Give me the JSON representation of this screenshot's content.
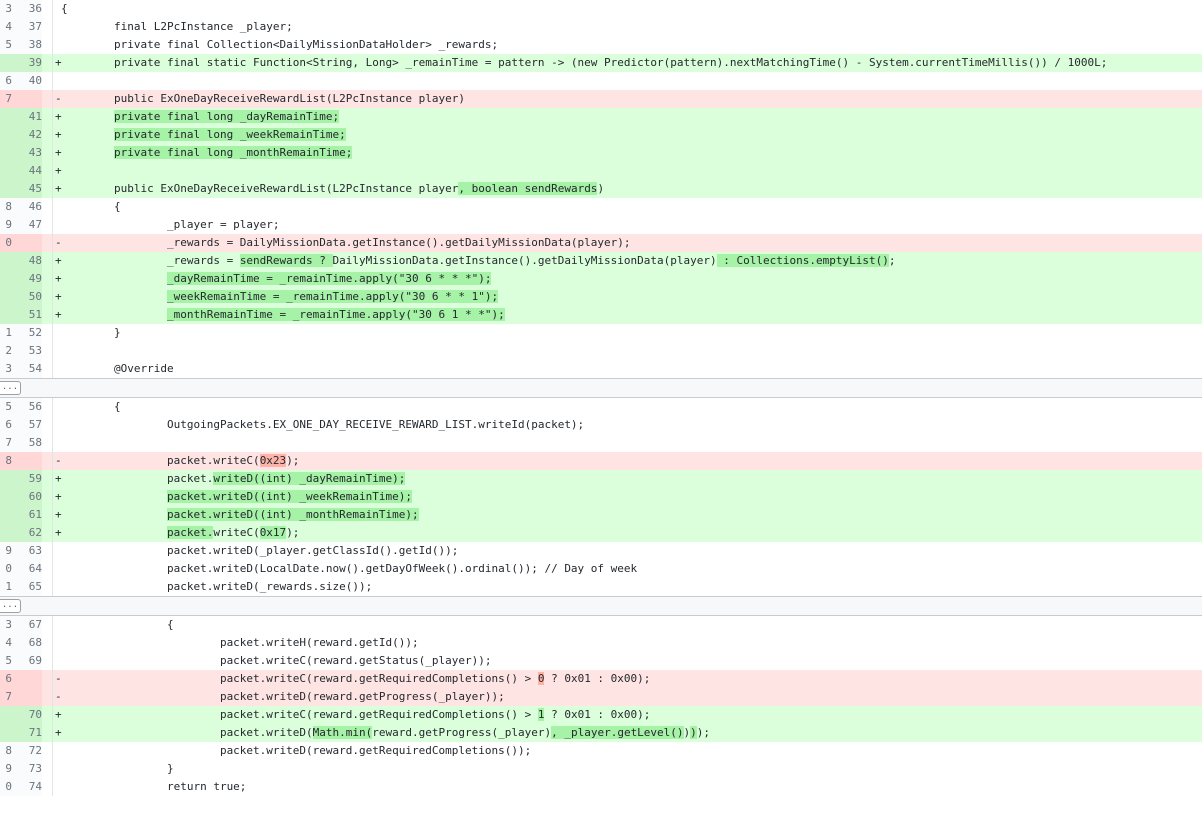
{
  "expand_label": "...",
  "lines": [
    {
      "t": "ctx",
      "o": "3",
      "n": "36",
      "s": "",
      "p": [
        [
          "{",
          ""
        ]
      ]
    },
    {
      "t": "ctx",
      "o": "4",
      "n": "37",
      "s": "",
      "p": [
        [
          "        final L2PcInstance _player;",
          ""
        ]
      ]
    },
    {
      "t": "ctx",
      "o": "5",
      "n": "38",
      "s": "",
      "p": [
        [
          "        private final Collection<DailyMissionDataHolder> _rewards;",
          ""
        ]
      ]
    },
    {
      "t": "add",
      "o": "",
      "n": "39",
      "s": "+",
      "p": [
        [
          "        private final static Function<String, Long> _remainTime = pattern -> (new Predictor(pattern).nextMatchingTime() - System.currentTimeMillis()) / 1000L;",
          ""
        ]
      ]
    },
    {
      "t": "ctx",
      "o": "6",
      "n": "40",
      "s": "",
      "p": [
        [
          "",
          ""
        ]
      ]
    },
    {
      "t": "del",
      "o": "7",
      "n": "",
      "s": "-",
      "p": [
        [
          "        public ExOneDayReceiveRewardList(L2PcInstance player)",
          ""
        ]
      ]
    },
    {
      "t": "add",
      "o": "",
      "n": "41",
      "s": "+",
      "p": [
        [
          "        ",
          ""
        ],
        [
          "private final long _dayRemainTime;",
          "h"
        ]
      ]
    },
    {
      "t": "add",
      "o": "",
      "n": "42",
      "s": "+",
      "p": [
        [
          "        ",
          ""
        ],
        [
          "private final long _weekRemainTime;",
          "h"
        ]
      ]
    },
    {
      "t": "add",
      "o": "",
      "n": "43",
      "s": "+",
      "p": [
        [
          "        ",
          ""
        ],
        [
          "private final long _monthRemainTime;",
          "h"
        ]
      ]
    },
    {
      "t": "add",
      "o": "",
      "n": "44",
      "s": "+",
      "p": [
        [
          "",
          ""
        ]
      ]
    },
    {
      "t": "add",
      "o": "",
      "n": "45",
      "s": "+",
      "p": [
        [
          "        public ExOneDayReceiveRewardList(L2PcInstance player",
          ""
        ],
        [
          ", boolean sendRewards",
          "h"
        ],
        [
          ")",
          ""
        ]
      ]
    },
    {
      "t": "ctx",
      "o": "8",
      "n": "46",
      "s": "",
      "p": [
        [
          "        {",
          ""
        ]
      ]
    },
    {
      "t": "ctx",
      "o": "9",
      "n": "47",
      "s": "",
      "p": [
        [
          "                _player = player;",
          ""
        ]
      ]
    },
    {
      "t": "del",
      "o": "0",
      "n": "",
      "s": "-",
      "p": [
        [
          "                _rewards = DailyMissionData.getInstance().getDailyMissionData(player);",
          ""
        ]
      ]
    },
    {
      "t": "add",
      "o": "",
      "n": "48",
      "s": "+",
      "p": [
        [
          "                _rewards = ",
          ""
        ],
        [
          "sendRewards ? ",
          "h"
        ],
        [
          "DailyMissionData.getInstance().getDailyMissionData(player)",
          ""
        ],
        [
          " : Collections.emptyList()",
          "h"
        ],
        [
          ";",
          ""
        ]
      ]
    },
    {
      "t": "add",
      "o": "",
      "n": "49",
      "s": "+",
      "p": [
        [
          "                ",
          ""
        ],
        [
          "_dayRemainTime = _remainTime.apply(\"30 6 * * *\");",
          "h"
        ]
      ]
    },
    {
      "t": "add",
      "o": "",
      "n": "50",
      "s": "+",
      "p": [
        [
          "                ",
          ""
        ],
        [
          "_weekRemainTime = _remainTime.apply(\"30 6 * * 1\");",
          "h"
        ]
      ]
    },
    {
      "t": "add",
      "o": "",
      "n": "51",
      "s": "+",
      "p": [
        [
          "                ",
          ""
        ],
        [
          "_monthRemainTime = _remainTime.apply(\"30 6 1 * *\");",
          "h"
        ]
      ]
    },
    {
      "t": "ctx",
      "o": "1",
      "n": "52",
      "s": "",
      "p": [
        [
          "        }",
          ""
        ]
      ]
    },
    {
      "t": "ctx",
      "o": "2",
      "n": "53",
      "s": "",
      "p": [
        [
          "",
          ""
        ]
      ]
    },
    {
      "t": "ctx",
      "o": "3",
      "n": "54",
      "s": "",
      "p": [
        [
          "        @Override",
          ""
        ]
      ]
    },
    {
      "t": "exp"
    },
    {
      "t": "ctx",
      "o": "5",
      "n": "56",
      "s": "",
      "p": [
        [
          "        {",
          ""
        ]
      ]
    },
    {
      "t": "ctx",
      "o": "6",
      "n": "57",
      "s": "",
      "p": [
        [
          "                OutgoingPackets.EX_ONE_DAY_RECEIVE_REWARD_LIST.writeId(packet);",
          ""
        ]
      ]
    },
    {
      "t": "ctx",
      "o": "7",
      "n": "58",
      "s": "",
      "p": [
        [
          "",
          ""
        ]
      ]
    },
    {
      "t": "del",
      "o": "8",
      "n": "",
      "s": "-",
      "p": [
        [
          "                packet.writeC(",
          ""
        ],
        [
          "0x23",
          "h"
        ],
        [
          ");",
          ""
        ]
      ]
    },
    {
      "t": "add",
      "o": "",
      "n": "59",
      "s": "+",
      "p": [
        [
          "                packet.",
          ""
        ],
        [
          "writeD((int) _dayRemainTime);",
          "h"
        ]
      ]
    },
    {
      "t": "add",
      "o": "",
      "n": "60",
      "s": "+",
      "p": [
        [
          "                ",
          ""
        ],
        [
          "packet.writeD((int) _weekRemainTime);",
          "h"
        ]
      ]
    },
    {
      "t": "add",
      "o": "",
      "n": "61",
      "s": "+",
      "p": [
        [
          "                ",
          ""
        ],
        [
          "packet.writeD((int) _monthRemainTime);",
          "h"
        ]
      ]
    },
    {
      "t": "add",
      "o": "",
      "n": "62",
      "s": "+",
      "p": [
        [
          "                ",
          ""
        ],
        [
          "packet.",
          "h"
        ],
        [
          "writeC(",
          ""
        ],
        [
          "0x17",
          "h"
        ],
        [
          ");",
          ""
        ]
      ]
    },
    {
      "t": "ctx",
      "o": "9",
      "n": "63",
      "s": "",
      "p": [
        [
          "                packet.writeD(_player.getClassId().getId());",
          ""
        ]
      ]
    },
    {
      "t": "ctx",
      "o": "0",
      "n": "64",
      "s": "",
      "p": [
        [
          "                packet.writeD(LocalDate.now().getDayOfWeek().ordinal()); // Day of week",
          ""
        ]
      ]
    },
    {
      "t": "ctx",
      "o": "1",
      "n": "65",
      "s": "",
      "p": [
        [
          "                packet.writeD(_rewards.size());",
          ""
        ]
      ]
    },
    {
      "t": "exp"
    },
    {
      "t": "ctx",
      "o": "3",
      "n": "67",
      "s": "",
      "p": [
        [
          "                {",
          ""
        ]
      ]
    },
    {
      "t": "ctx",
      "o": "4",
      "n": "68",
      "s": "",
      "p": [
        [
          "                        packet.writeH(reward.getId());",
          ""
        ]
      ]
    },
    {
      "t": "ctx",
      "o": "5",
      "n": "69",
      "s": "",
      "p": [
        [
          "                        packet.writeC(reward.getStatus(_player));",
          ""
        ]
      ]
    },
    {
      "t": "del",
      "o": "6",
      "n": "",
      "s": "-",
      "p": [
        [
          "                        packet.writeC(reward.getRequiredCompletions() > ",
          ""
        ],
        [
          "0",
          "h"
        ],
        [
          " ? 0x01 : 0x00);",
          ""
        ]
      ]
    },
    {
      "t": "del",
      "o": "7",
      "n": "",
      "s": "-",
      "p": [
        [
          "                        packet.writeD(reward.getProgress(_player));",
          ""
        ]
      ]
    },
    {
      "t": "add",
      "o": "",
      "n": "70",
      "s": "+",
      "p": [
        [
          "                        packet.writeC(reward.getRequiredCompletions() > ",
          ""
        ],
        [
          "1",
          "h"
        ],
        [
          " ? 0x01 : 0x00);",
          ""
        ]
      ]
    },
    {
      "t": "add",
      "o": "",
      "n": "71",
      "s": "+",
      "p": [
        [
          "                        packet.writeD(",
          ""
        ],
        [
          "Math.min(",
          "h"
        ],
        [
          "reward.getProgress(_player)",
          ""
        ],
        [
          ", _player.getLevel()",
          "h"
        ],
        [
          ")",
          ""
        ],
        [
          ")",
          "h"
        ],
        [
          ");",
          ""
        ]
      ]
    },
    {
      "t": "ctx",
      "o": "8",
      "n": "72",
      "s": "",
      "p": [
        [
          "                        packet.writeD(reward.getRequiredCompletions());",
          ""
        ]
      ]
    },
    {
      "t": "ctx",
      "o": "9",
      "n": "73",
      "s": "",
      "p": [
        [
          "                }",
          ""
        ]
      ]
    },
    {
      "t": "ctx",
      "o": "0",
      "n": "74",
      "s": "",
      "p": [
        [
          "                return true;",
          ""
        ]
      ]
    }
  ]
}
